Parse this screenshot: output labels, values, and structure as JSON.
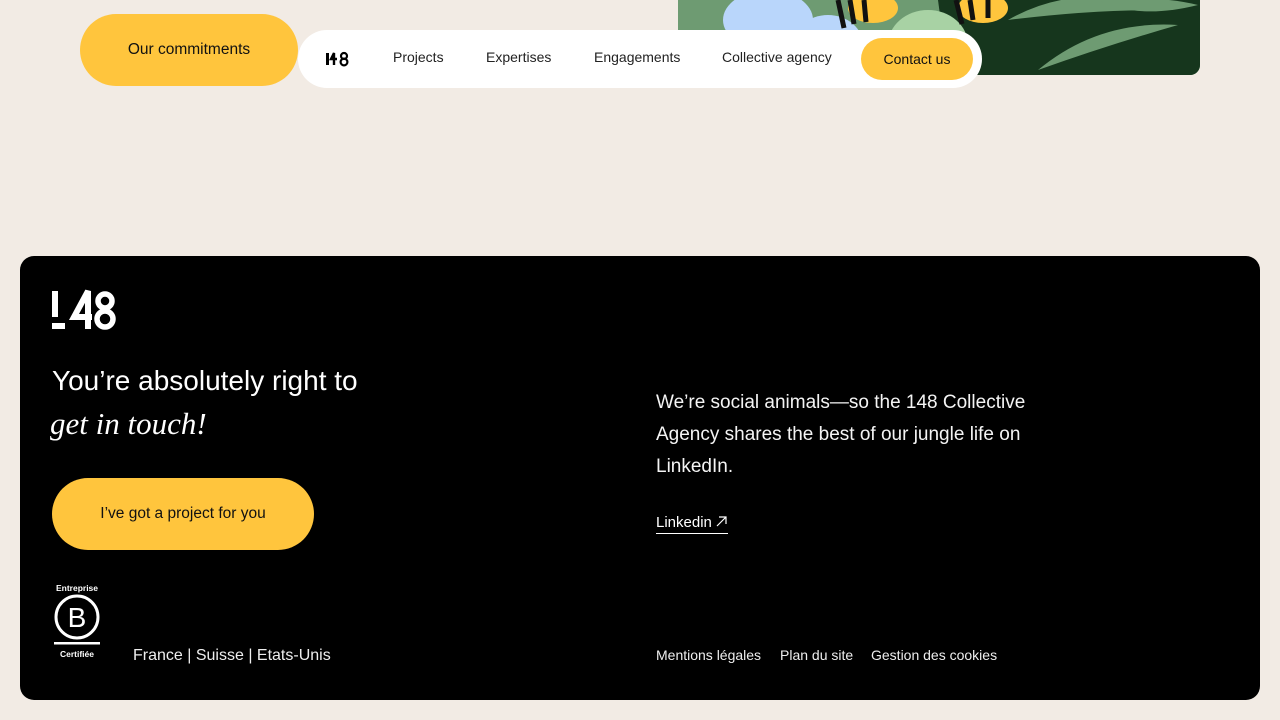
{
  "header": {
    "commitments_label": "Our commitments",
    "logo_text": "148",
    "nav": [
      "Projects",
      "Expertises",
      "Engagements",
      "Collective agency"
    ],
    "contact_label": "Contact us"
  },
  "footer": {
    "logo_text": "148",
    "title": "You’re absolutely right to",
    "title_emphasis": "get in touch!",
    "project_button": "I’ve got a project for you",
    "bcorp_top": "Entreprise",
    "bcorp_bottom": "Certifiée",
    "countries": "France | Suisse | Etats-Unis",
    "social_text": "We’re social animals—so the 148 Collective Agency shares the best of our jungle life on LinkedIn.",
    "linkedin_label": "Linkedin",
    "legal_links": [
      "Mentions légales",
      "Plan du site",
      "Gestion des cookies"
    ]
  },
  "colors": {
    "background": "#f2ebe4",
    "accent": "#ffc53d",
    "footer_bg": "#000000"
  }
}
